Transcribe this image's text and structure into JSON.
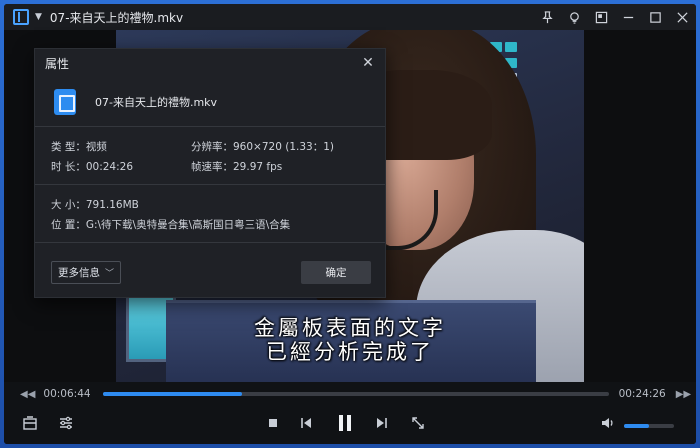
{
  "window": {
    "title": "07-来自天上的禮物.mkv"
  },
  "dialog": {
    "title": "属性",
    "file_name": "07-来自天上的禮物.mkv",
    "type_label": "类 型：视频",
    "resolution_label": "分辨率：960×720 (1.33：1)",
    "duration_label": "时 长：00:24:26",
    "framerate_label": "帧速率：29.97 fps",
    "size_label": "大 小：791.16MB",
    "location_label": "位 置：G:\\待下载\\奥特曼合集\\高斯国日粤三语\\合集",
    "more_info_button": "更多信息",
    "ok_button": "确定"
  },
  "video": {
    "subtitle_line1": "金屬板表面的文字",
    "subtitle_line2": "已經分析完成了"
  },
  "playback": {
    "current_time": "00:06:44",
    "total_time": "00:24:26",
    "progress_fraction": 0.276,
    "volume_fraction": 0.5
  },
  "colors": {
    "accent": "#2e8bf0",
    "panel_lights": [
      "#c23a3a",
      "#1b9e6e",
      "#d9c13a",
      "#2fb7c9",
      "#b9c6d8",
      "#d94a3a"
    ]
  },
  "icons": {
    "titlebar": [
      "app-logo-icon",
      "menu-caret-icon",
      "pin-icon",
      "lightbulb-icon",
      "mini-mode-icon",
      "minimize-icon",
      "maximize-icon",
      "close-icon"
    ],
    "controls": [
      "playlist-icon",
      "settings-sliders-icon",
      "stop-icon",
      "previous-icon",
      "pause-icon",
      "next-icon",
      "fullscreen-icon",
      "volume-icon"
    ]
  }
}
